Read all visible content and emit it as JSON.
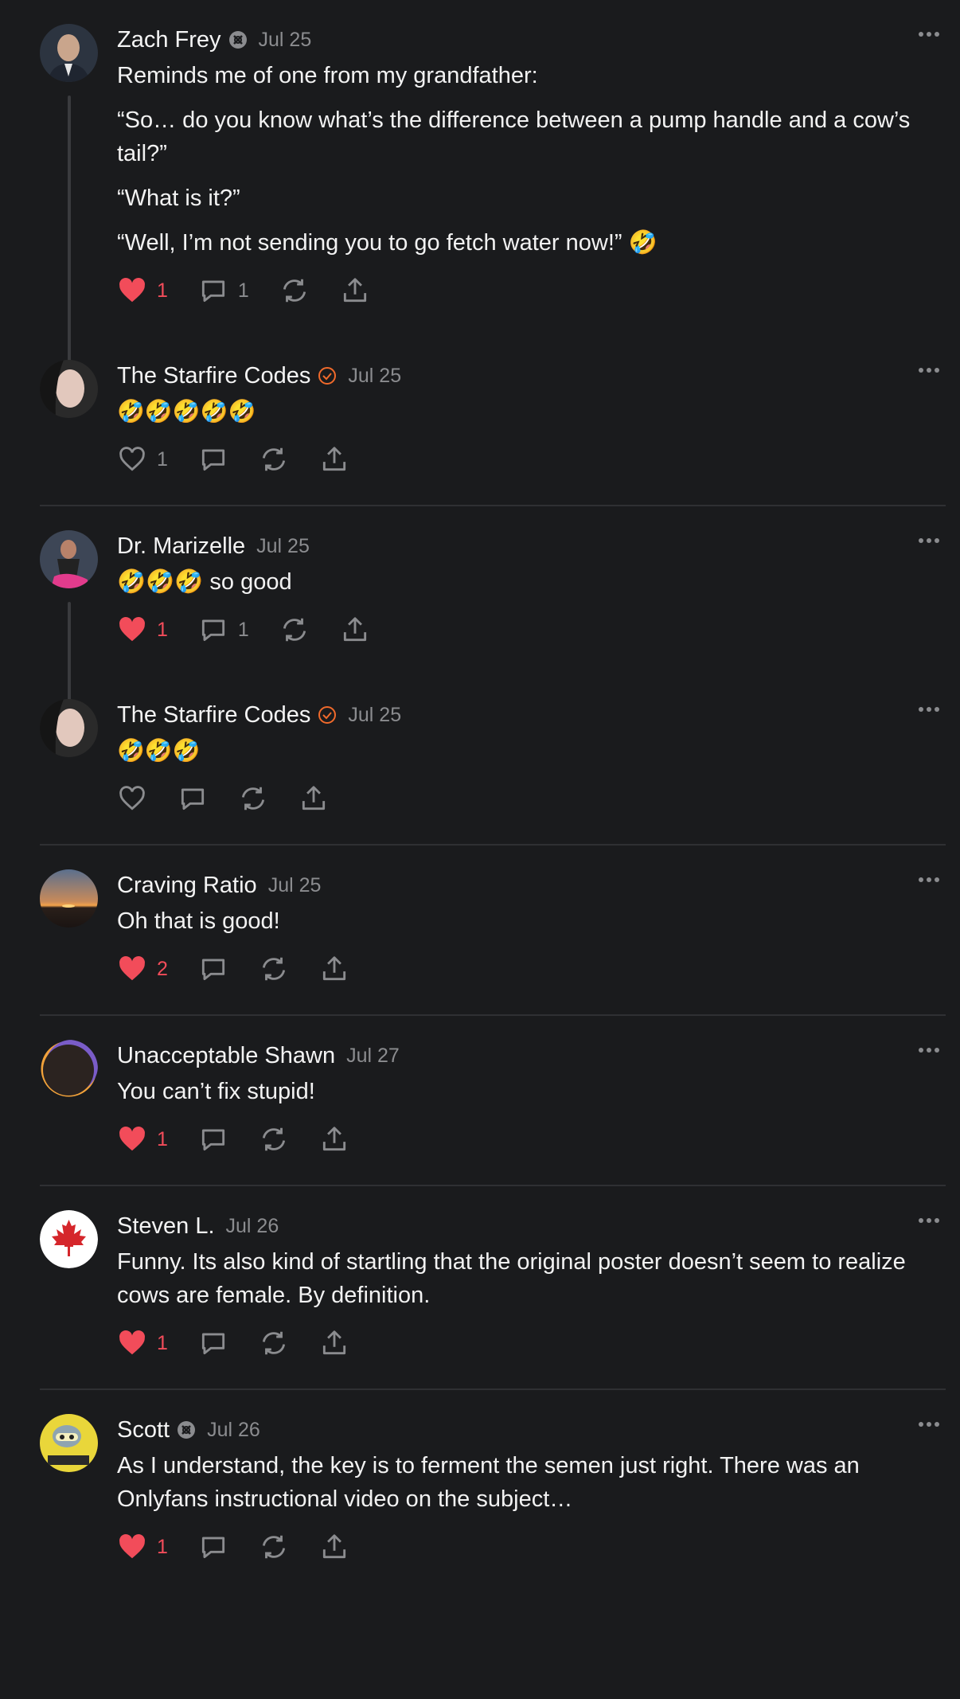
{
  "colors": {
    "background": "#1a1b1d",
    "like": "#f24c5a",
    "verified": "#f06a2b",
    "muted": "#8b8c8f"
  },
  "comments": [
    {
      "name": "Zach Frey",
      "badge": "gray-badge-icon",
      "date": "Jul 25",
      "paragraphs": [
        "Reminds me of one from my grandfather:",
        "“So… do you know what’s the difference between a pump handle and a cow’s tail?”",
        "“What is it?”",
        "“Well, I’m not sending you to go fetch water now!” 🤣"
      ],
      "likes": "1",
      "liked": true,
      "replies": "1"
    },
    {
      "name": "The Starfire Codes",
      "badge": "verified-check-icon",
      "date": "Jul 25",
      "paragraphs": [
        "🤣🤣🤣🤣🤣"
      ],
      "likes": "1",
      "liked": false,
      "replies": ""
    },
    {
      "name": "Dr. Marizelle",
      "badge": "",
      "date": "Jul 25",
      "paragraphs": [
        "🤣🤣🤣 so good"
      ],
      "likes": "1",
      "liked": true,
      "replies": "1"
    },
    {
      "name": "The Starfire Codes",
      "badge": "verified-check-icon",
      "date": "Jul 25",
      "paragraphs": [
        "🤣🤣🤣"
      ],
      "likes": "",
      "liked": false,
      "replies": ""
    },
    {
      "name": "Craving Ratio",
      "badge": "",
      "date": "Jul 25",
      "paragraphs": [
        "Oh that is good!"
      ],
      "likes": "2",
      "liked": true,
      "replies": ""
    },
    {
      "name": "Unacceptable Shawn",
      "badge": "",
      "date": "Jul 27",
      "paragraphs": [
        "You can’t fix stupid!"
      ],
      "likes": "1",
      "liked": true,
      "replies": ""
    },
    {
      "name": "Steven L.",
      "badge": "",
      "date": "Jul 26",
      "paragraphs": [
        "Funny. Its also kind of startling that the original poster doesn’t seem to realize cows are female. By definition."
      ],
      "likes": "1",
      "liked": true,
      "replies": ""
    },
    {
      "name": "Scott",
      "badge": "gray-badge-icon",
      "date": "Jul 26",
      "paragraphs": [
        "As I understand, the key is to ferment the semen just right. There was an Onlyfans instructional video on the subject…"
      ],
      "likes": "1",
      "liked": true,
      "replies": ""
    }
  ]
}
